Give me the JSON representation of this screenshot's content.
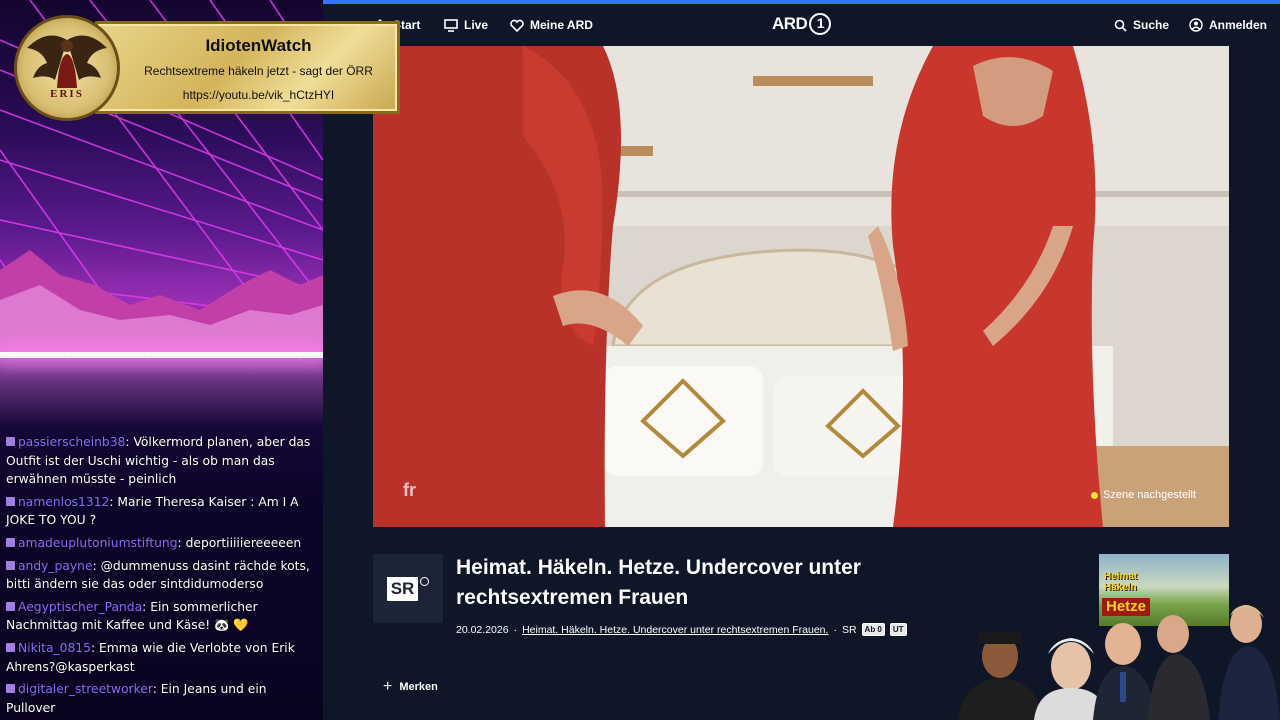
{
  "banner": {
    "title": "IdiotenWatch",
    "subtitle": "Rechtsextreme häkeln jetzt - sagt der ÖRR",
    "url": "https://youtu.be/vik_hCtzHYI",
    "logo_text": "ERIS"
  },
  "chat": [
    {
      "user": "passierscheinb38",
      "text": "Völkermord planen, aber das Outfit ist der Uschi wichtig - als ob man das erwähnen müsste - peinlich"
    },
    {
      "user": "namenlos1312",
      "text": "Marie Theresa Kaiser : Am I A JOKE TO YOU ?"
    },
    {
      "user": "amadeuplutoniumstiftung",
      "text": "deportiiiiiereeeeen"
    },
    {
      "user": "andy_payne",
      "text": "@dummenuss dasint rächde kots, bitti ändern sie das oder sintdidumoderso"
    },
    {
      "user": "Aegyptischer_Panda",
      "text": "Ein sommerlicher Nachmittag mit Kaffee und Käse! 🐼 💛"
    },
    {
      "user": "Nikita_0815",
      "text": "Emma wie die Verlobte von Erik Ahrens?@kasperkast"
    },
    {
      "user": "digitaler_streetworker",
      "text": "Ein Jeans und ein Pullover"
    }
  ],
  "nav": {
    "start": "Start",
    "live": "Live",
    "meine_ard": "Meine ARD",
    "logo": "ARD",
    "logo_one": "1",
    "suche": "Suche",
    "anmelden": "Anmelden"
  },
  "video": {
    "tag": "Szene nachgestellt",
    "watermark": "fr"
  },
  "program": {
    "channel": "SR",
    "title": "Heimat. Häkeln. Hetze. Undercover unter rechtsextremen Frauen",
    "date": "20.02.2026",
    "series_link": "Heimat. Häkeln. Hetze. Undercover unter rechtsextremen Frauen.",
    "sender": "SR",
    "badge1": "Ab 0",
    "badge2": "UT",
    "merken": "Merken"
  },
  "thumbnail": {
    "line1": "Heimat",
    "line2": "Häkeln",
    "line3": "Hetze"
  },
  "colors": {
    "accent": "#2f77ff",
    "page_bg": "#0e1628",
    "chat_user": "#8a6bff",
    "banner_gold": "#d4b45c"
  }
}
